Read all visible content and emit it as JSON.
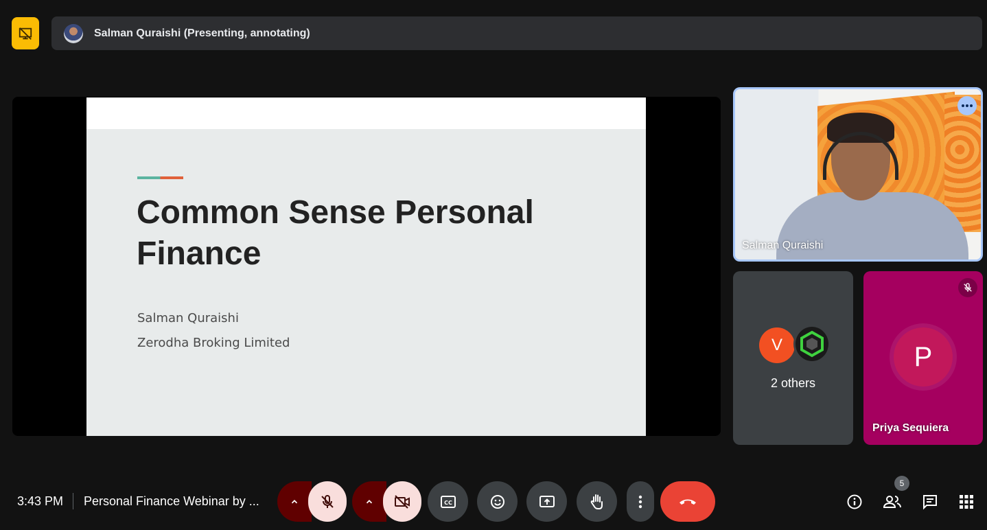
{
  "topbar": {
    "presenter_title": "Salman Quraishi (Presenting, annotating)"
  },
  "slide": {
    "title_line1": "Common Sense Personal",
    "title_line2": "Finance",
    "author": "Salman Quraishi",
    "company": "Zerodha Broking Limited"
  },
  "tiles": {
    "main_label": "Salman Quraishi",
    "others_initial": "V",
    "others_label": "2 others",
    "priya_initial": "P",
    "priya_label": "Priya Sequiera"
  },
  "bottombar": {
    "time": "3:43 PM",
    "separator": "|",
    "meeting_name": "Personal Finance Webinar by ...",
    "participants_count": "5"
  },
  "colors": {
    "accent_present": "#fbbc04",
    "hangup": "#ea4335",
    "active_tile_border": "#a8c7fa",
    "priya_tile": "#a5005f"
  },
  "icons": {
    "present": "presentation-off-icon",
    "mic": "mic-off-icon",
    "camera": "camera-off-icon",
    "captions": "captions-icon",
    "emoji": "emoji-icon",
    "share": "present-screen-icon",
    "hand": "raise-hand-icon",
    "more": "more-vert-icon",
    "hangup": "call-end-icon",
    "info": "info-icon",
    "people": "people-icon",
    "chat": "chat-icon",
    "activities": "apps-grid-icon"
  }
}
